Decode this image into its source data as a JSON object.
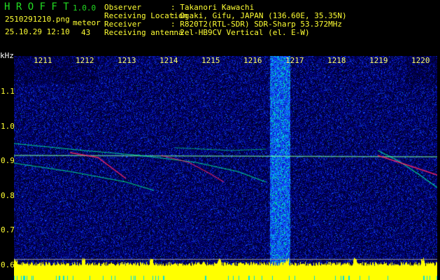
{
  "app": {
    "name": "H R O F F T",
    "version": "1.0.0"
  },
  "file": {
    "name": "2510291210.png",
    "datetime": "25.10.29 12:10"
  },
  "meteor": {
    "label": "meteor",
    "count": "43"
  },
  "info": [
    {
      "label": "Observer",
      "value": ": Takanori Kawachi"
    },
    {
      "label": "Receiving Location",
      "value": ": Ogaki, Gifu, JAPAN (136.60E, 35.35N)"
    },
    {
      "label": "Receiver",
      "value": ": R820T2(RTL-SDR) SDR-Sharp 53.372MHz"
    },
    {
      "label": "Receiving antenna",
      "value": ": 2el-HB9CV Vertical (el. E-W)"
    }
  ],
  "axis": {
    "y_unit": "kHz",
    "y_ticks": [
      "1.1",
      "1.0",
      "0.9",
      "0.8",
      "0.7",
      "0.6"
    ],
    "x_ticks": [
      "1211",
      "1212",
      "1213",
      "1214",
      "1215",
      "1216",
      "1217",
      "1218",
      "1219",
      "1220"
    ]
  },
  "colors": {
    "background": "#000000",
    "noise": "#1030c0",
    "signal": "#00ff80",
    "strong": "#ff2060",
    "level": "#ffff00"
  }
}
